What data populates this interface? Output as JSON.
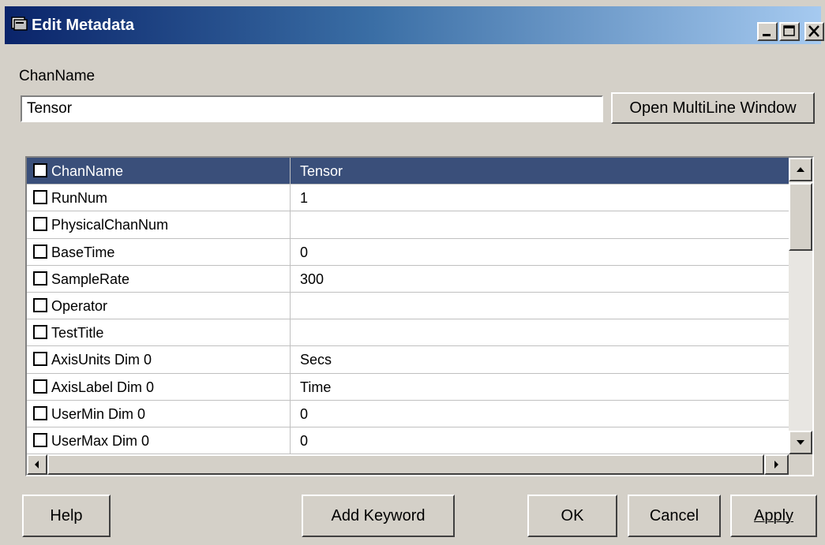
{
  "window": {
    "title": "Edit Metadata",
    "controls": {
      "minimize": "_",
      "maximize": "□",
      "close": "X"
    }
  },
  "chan_label": "ChanName",
  "chan_input": {
    "value": "Tensor"
  },
  "open_multiline_label": "Open MultiLine Window",
  "grid": {
    "rows": [
      {
        "name": "ChanName",
        "value": "Tensor",
        "selected": true
      },
      {
        "name": "RunNum",
        "value": "1"
      },
      {
        "name": "PhysicalChanNum",
        "value": ""
      },
      {
        "name": "BaseTime",
        "value": "0"
      },
      {
        "name": "SampleRate",
        "value": "300"
      },
      {
        "name": "Operator",
        "value": ""
      },
      {
        "name": "TestTitle",
        "value": ""
      },
      {
        "name": "AxisUnits Dim 0",
        "value": "Secs"
      },
      {
        "name": "AxisLabel Dim 0",
        "value": "Time"
      },
      {
        "name": "UserMin Dim 0",
        "value": "0"
      },
      {
        "name": "UserMax Dim 0",
        "value": "0"
      }
    ]
  },
  "buttons": {
    "help": "Help",
    "add_keyword": "Add Keyword",
    "ok": "OK",
    "cancel": "Cancel",
    "apply": "Apply"
  },
  "colors": {
    "selected_row": "#3a4f7a",
    "title_start": "#0a246a",
    "title_end": "#a6caf0",
    "face": "#d4d0c8"
  }
}
